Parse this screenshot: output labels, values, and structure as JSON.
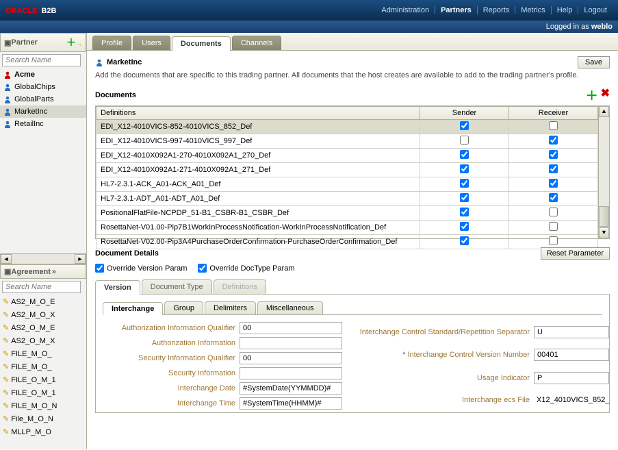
{
  "header": {
    "logo_main": "ORACLE",
    "logo_sub": "B2B",
    "nav": [
      "Administration",
      "Partners",
      "Reports",
      "Metrics",
      "Help",
      "Logout"
    ],
    "nav_active": 1,
    "login_prefix": "Logged in as ",
    "login_user": "weblo"
  },
  "sidebar": {
    "partner_label": "Partner",
    "search_placeholder": "Search Name",
    "partners": [
      {
        "name": "Acme",
        "host": true,
        "color": "#c00"
      },
      {
        "name": "GlobalChips",
        "host": false,
        "color": "#2a70c0"
      },
      {
        "name": "GlobalParts",
        "host": false,
        "color": "#2a70c0"
      },
      {
        "name": "MarketInc",
        "host": false,
        "selected": true,
        "color": "#2a70c0"
      },
      {
        "name": "RetailInc",
        "host": false,
        "color": "#2a70c0"
      }
    ],
    "agreement_label": "Agreement",
    "agreements": [
      "AS2_M_O_E",
      "AS2_M_O_X",
      "AS2_O_M_E",
      "AS2_O_M_X",
      "FILE_M_O_",
      "FILE_M_O_",
      "FILE_O_M_1",
      "FILE_O_M_1",
      "FILE_M_O_N",
      "File_M_O_N",
      "MLLP_M_O"
    ]
  },
  "tabs": {
    "items": [
      "Profile",
      "Users",
      "Documents",
      "Channels"
    ],
    "active": 2
  },
  "page": {
    "title": "MarketInc",
    "save": "Save",
    "desc": "Add the documents that are specific to this trading partner. All documents that the host creates are available to add to the trading partner's profile.",
    "docs_label": "Documents",
    "cols": {
      "def": "Definitions",
      "send": "Sender",
      "recv": "Receiver"
    },
    "rows": [
      {
        "def": "EDI_X12-4010VICS-852-4010VICS_852_Def",
        "send": true,
        "recv": false,
        "sel": true
      },
      {
        "def": "EDI_X12-4010VICS-997-4010VICS_997_Def",
        "send": false,
        "recv": true
      },
      {
        "def": "EDI_X12-4010X092A1-270-4010X092A1_270_Def",
        "send": true,
        "recv": true
      },
      {
        "def": "EDI_X12-4010X092A1-271-4010X092A1_271_Def",
        "send": true,
        "recv": true
      },
      {
        "def": "HL7-2.3.1-ACK_A01-ACK_A01_Def",
        "send": true,
        "recv": true
      },
      {
        "def": "HL7-2.3.1-ADT_A01-ADT_A01_Def",
        "send": true,
        "recv": true
      },
      {
        "def": "PositionalFlatFile-NCPDP_51-B1_CSBR-B1_CSBR_Def",
        "send": true,
        "recv": false
      },
      {
        "def": "RosettaNet-V01.00-Pip7B1WorkInProcessNotification-WorkInProcessNotification_Def",
        "send": true,
        "recv": false
      },
      {
        "def": "RosettaNet-V02.00-Pip3A4PurchaseOrderConfirmation-PurchaseOrderConfirmation_Def",
        "send": true,
        "recv": false
      }
    ],
    "details_label": "Document Details",
    "reset": "Reset Parameter",
    "ov_version": "Override Version Param",
    "ov_doctype": "Override DocType Param",
    "subtabs": [
      "Version",
      "Document Type",
      "Definitions"
    ],
    "innertabs": [
      "Interchange",
      "Group",
      "Delimiters",
      "Miscellaneous"
    ],
    "form_left": [
      {
        "label": "Authorization Information Qualifier",
        "val": "00"
      },
      {
        "label": "Authorization Information",
        "val": ""
      },
      {
        "label": "Security Information Qualifier",
        "val": "00"
      },
      {
        "label": "Security Information",
        "val": ""
      },
      {
        "label": "Interchange Date",
        "val": "#SystemDate(YYMMDD)#"
      },
      {
        "label": "Interchange Time",
        "val": "#SystemTime(HHMM)#"
      }
    ],
    "form_right": [
      {
        "label": "Interchange Control Standard/Repetition Separator",
        "val": "U"
      },
      {
        "label": "Interchange Control Version Number",
        "val": "00401",
        "req": true
      },
      {
        "label": "Usage Indicator",
        "val": "P"
      },
      {
        "label": "Interchange ecs File",
        "val": "X12_4010VICS_852_",
        "ro": true
      }
    ]
  }
}
